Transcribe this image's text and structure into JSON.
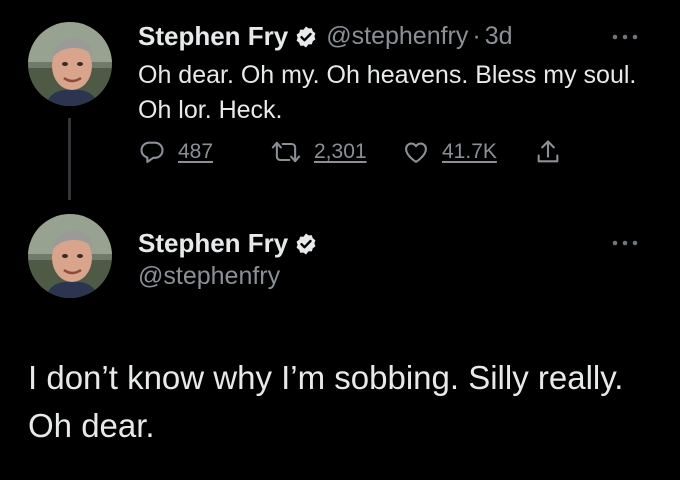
{
  "tweet1": {
    "display_name": "Stephen Fry",
    "handle": "@stephenfry",
    "separator": "·",
    "time": "3d",
    "text": "Oh dear. Oh my. Oh heavens. Bless my soul. Oh lor. Heck.",
    "reply_count": "487",
    "retweet_count": "2,301",
    "like_count": "41.7K",
    "icons": [
      "verified-badge-icon",
      "reply-icon",
      "retweet-icon",
      "like-icon",
      "share-icon",
      "more-icon"
    ]
  },
  "tweet2": {
    "display_name": "Stephen Fry",
    "handle": "@stephenfry",
    "text": "I don’t know why I’m sobbing. Silly really. Oh dear.",
    "icons": [
      "verified-badge-icon",
      "more-icon"
    ]
  },
  "colors": {
    "background": "#000000",
    "text": "#e7e9ea",
    "muted": "#8b9097",
    "thread_line": "#333639"
  }
}
